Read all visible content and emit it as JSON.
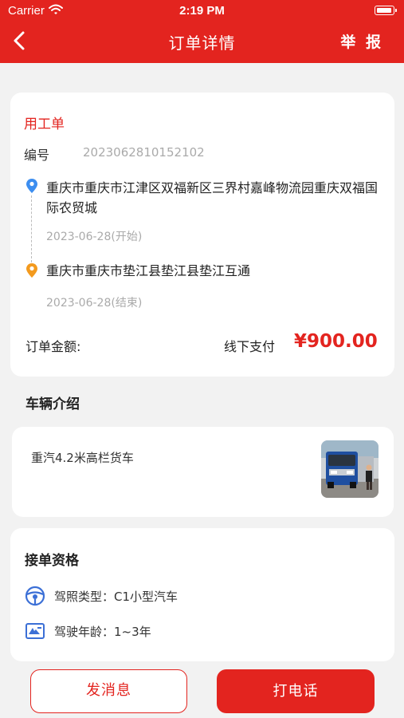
{
  "status_bar": {
    "carrier": "Carrier",
    "time": "2:19 PM"
  },
  "header": {
    "title": "订单详情",
    "report_label": "举 报"
  },
  "order": {
    "type": "用工单",
    "number_label": "编号",
    "number": "2023062810152102",
    "start_address": "重庆市重庆市江津区双福新区三界村嘉峰物流园重庆双福国际农贸城",
    "start_date": "2023-06-28(开始)",
    "end_address": "重庆市重庆市垫江县垫江县垫江互通",
    "end_date": "2023-06-28(结束)",
    "amount_label": "订单金额:",
    "payment_method": "线下支付",
    "price": "¥900.00"
  },
  "vehicle": {
    "section_title": "车辆介绍",
    "description": "重汽4.2米高栏货车"
  },
  "qualification": {
    "section_title": "接单资格",
    "license_type": "驾照类型：C1小型汽车",
    "driving_years": "驾驶年龄：1~3年"
  },
  "actions": {
    "message_label": "发消息",
    "call_label": "打电话"
  },
  "colors": {
    "brand": "#e3241f",
    "start_pin": "#3d8ef0",
    "end_pin": "#f39a1e",
    "icon_blue": "#3b6fd6"
  },
  "icons": [
    "back-arrow-icon",
    "location-pin-icon",
    "steering-wheel-icon",
    "id-card-icon",
    "wifi-icon",
    "battery-icon"
  ]
}
